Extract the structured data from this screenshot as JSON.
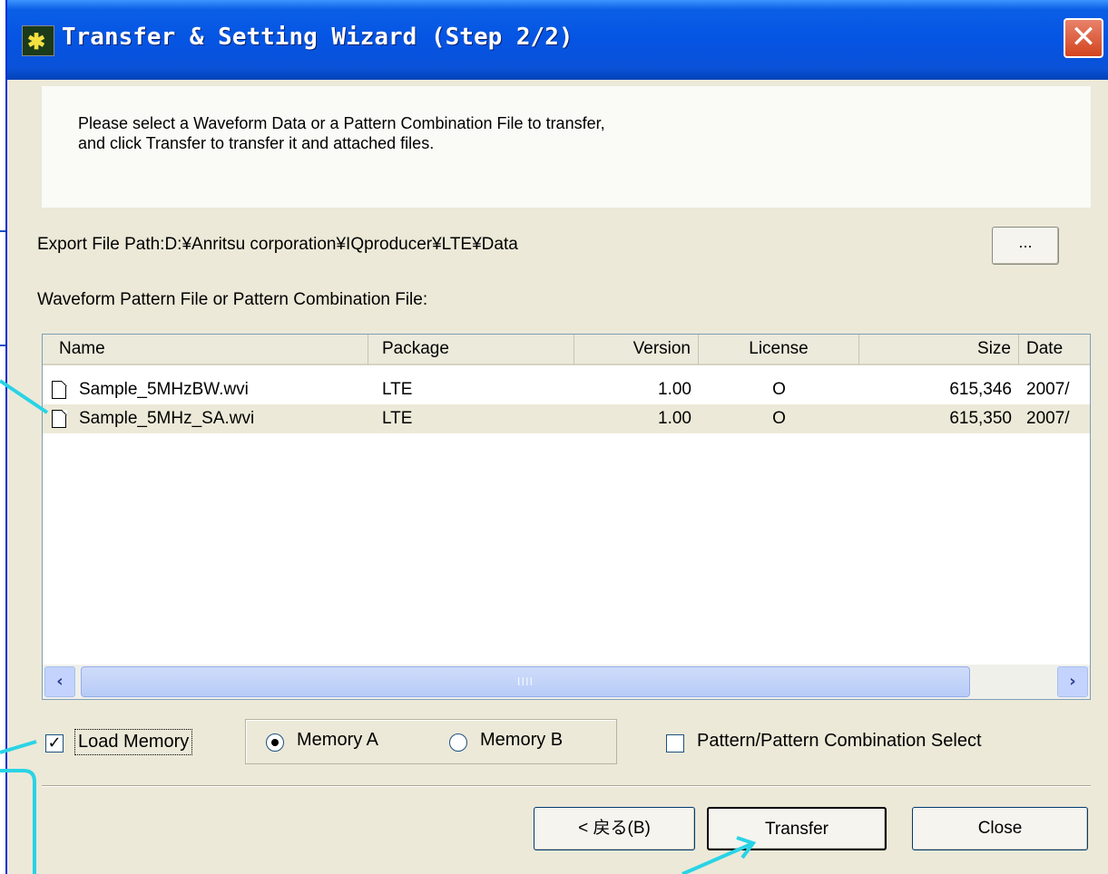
{
  "window": {
    "title": "Transfer & Setting Wizard (Step 2/2)",
    "close_glyph": "✕"
  },
  "instruction": {
    "line1": "Please select a Waveform Data or a Pattern Combination File to transfer,",
    "line2": "and click Transfer to transfer it and attached files."
  },
  "export_path": {
    "text": "Export File Path:D:¥Anritsu corporation¥IQproducer¥LTE¥Data",
    "browse_label": "..."
  },
  "list_label": "Waveform Pattern File or Pattern Combination File:",
  "table": {
    "columns": [
      "Name",
      "Package",
      "Version",
      "License",
      "Size",
      "Date"
    ],
    "rows": [
      {
        "name": "Sample_5MHzBW.wvi",
        "package": "LTE",
        "version": "1.00",
        "license": "O",
        "size": "615,346",
        "date": "2007/"
      },
      {
        "name": "Sample_5MHz_SA.wvi",
        "package": "LTE",
        "version": "1.00",
        "license": "O",
        "size": "615,350",
        "date": "2007/"
      }
    ],
    "scroll_thumb_grip": "IIII"
  },
  "options": {
    "load_memory_label": "Load Memory",
    "load_memory_checked": true,
    "memory_a_label": "Memory A",
    "memory_b_label": "Memory B",
    "selected_memory": "Memory A",
    "pattern_select_label": "Pattern/Pattern Combination Select",
    "pattern_select_checked": false
  },
  "buttons": {
    "back_label": "< 戻る(B)",
    "transfer_label": "Transfer",
    "close_label": "Close"
  },
  "colors": {
    "titlebar": "#0554e3",
    "window_bg": "#ece9d8",
    "callout": "#29d3e6",
    "selected_row": "#ece9d8"
  },
  "icons": {
    "app": "app-logo-icon",
    "file": "file-icon",
    "close": "close-icon",
    "scroll_left": "scroll-left-icon",
    "scroll_right": "scroll-right-icon"
  }
}
